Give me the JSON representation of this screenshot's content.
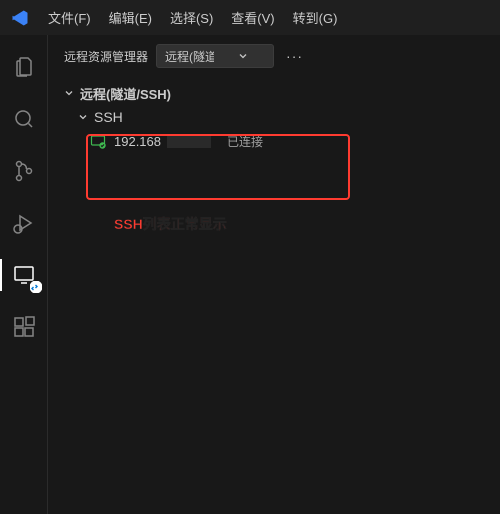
{
  "menu": {
    "file": "文件(F)",
    "edit": "编辑(E)",
    "select": "选择(S)",
    "view": "查看(V)",
    "go": "转到(G)"
  },
  "sidebar": {
    "title": "远程资源管理器",
    "dropdown_value": "远程(隧道/SSH)"
  },
  "tree": {
    "root_label": "远程(隧道/SSH)",
    "ssh_label": "SSH",
    "host_ip": "192.168",
    "host_status": "已连接"
  },
  "annotation": "SSH列表正常显示",
  "more": "···"
}
